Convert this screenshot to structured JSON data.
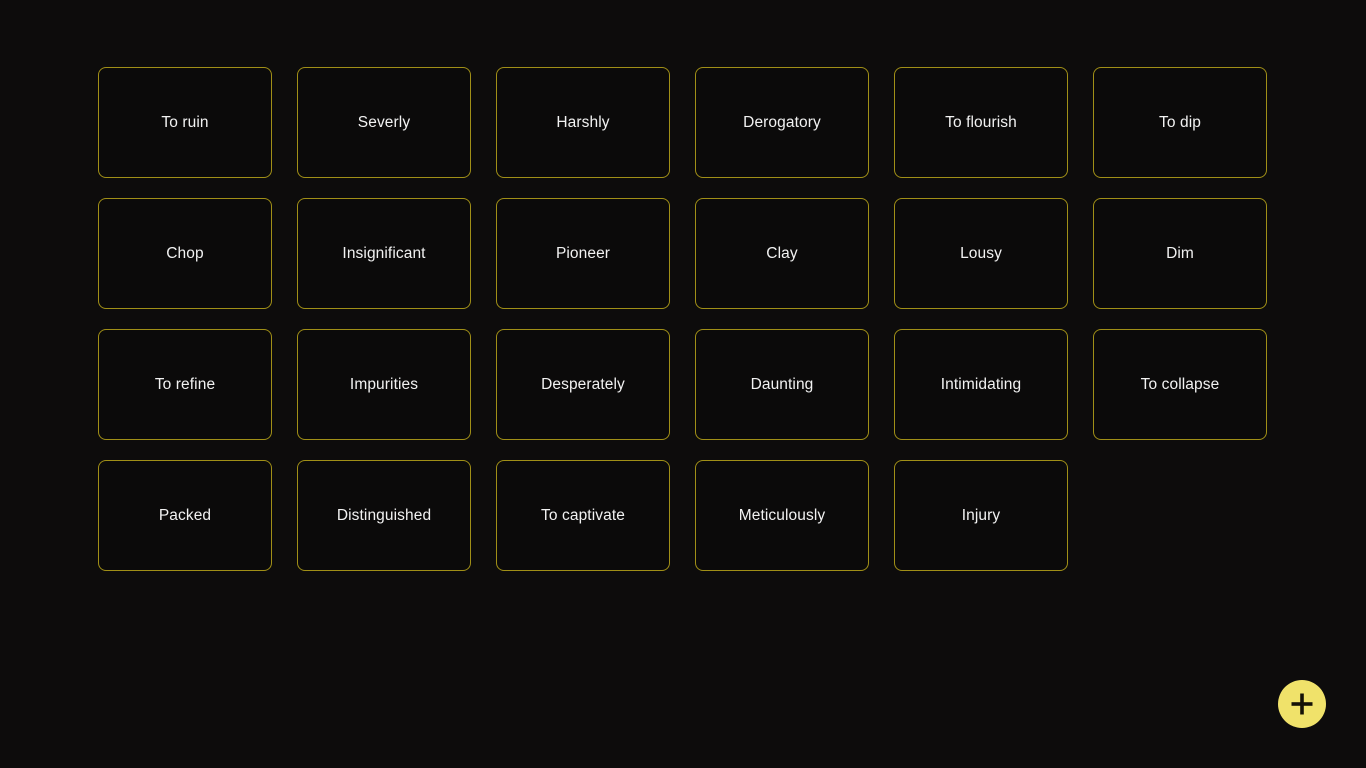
{
  "theme": {
    "page_background": "#0d0c0c",
    "card_background": "#0b0a0a",
    "card_border": "#a08f17",
    "card_text": "#f2f2f2",
    "accent": "#f0e26a",
    "fab_icon": "#141106"
  },
  "grid": {
    "columns": 6,
    "rows": 4,
    "cards": [
      {
        "label": "To ruin"
      },
      {
        "label": "Severly"
      },
      {
        "label": "Harshly"
      },
      {
        "label": "Derogatory"
      },
      {
        "label": "To flourish"
      },
      {
        "label": "To dip"
      },
      {
        "label": "Chop"
      },
      {
        "label": "Insignificant"
      },
      {
        "label": "Pioneer"
      },
      {
        "label": "Clay"
      },
      {
        "label": "Lousy"
      },
      {
        "label": "Dim"
      },
      {
        "label": "To refine"
      },
      {
        "label": "Impurities"
      },
      {
        "label": "Desperately"
      },
      {
        "label": "Daunting"
      },
      {
        "label": "Intimidating"
      },
      {
        "label": "To collapse"
      },
      {
        "label": "Packed"
      },
      {
        "label": "Distinguished"
      },
      {
        "label": "To captivate"
      },
      {
        "label": "Meticulously"
      },
      {
        "label": "Injury"
      }
    ]
  },
  "fab": {
    "icon": "plus-icon",
    "label": "+"
  }
}
